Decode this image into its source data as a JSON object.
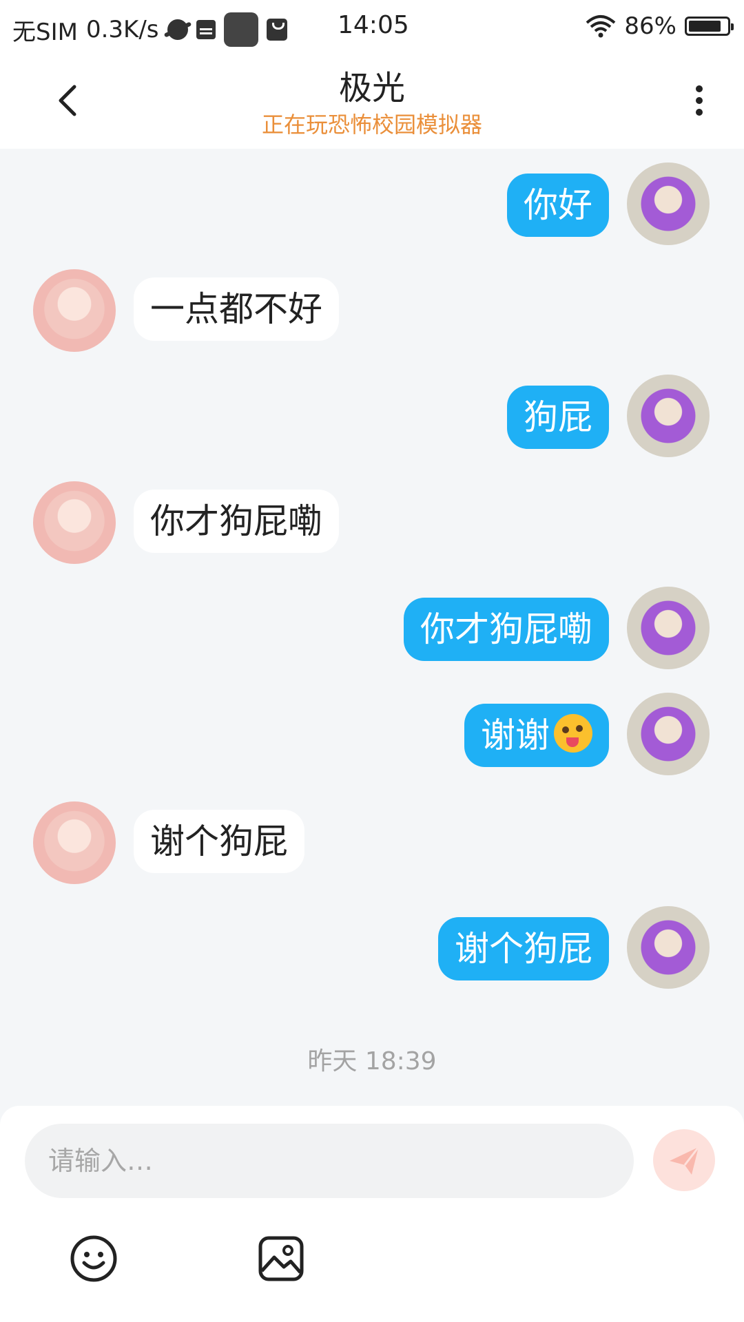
{
  "status_bar": {
    "carrier": "无SIM",
    "speed": "0.3K/s",
    "time": "14:05",
    "battery": "86%",
    "battery_level": 0.86
  },
  "header": {
    "title": "极光",
    "subtitle": "正在玩恐怖校园模拟器"
  },
  "messages": [
    {
      "side": "self",
      "text": "你好"
    },
    {
      "side": "other",
      "text": "一点都不好"
    },
    {
      "side": "self",
      "text": "狗屁"
    },
    {
      "side": "other",
      "text": "你才狗屁嘞"
    },
    {
      "side": "self",
      "text": "你才狗屁嘞"
    },
    {
      "side": "self",
      "text": "谢谢",
      "emoji": "winking-tongue-emoji"
    },
    {
      "side": "other",
      "text": "谢个狗屁"
    },
    {
      "side": "self",
      "text": "谢个狗屁"
    }
  ],
  "timestamp": "昨天 18:39",
  "input": {
    "placeholder": "请输入…",
    "value": ""
  },
  "colors": {
    "self_bubble": "#1fb0f5",
    "subtitle": "#ea8f3a",
    "send_button": "#fde1dc"
  },
  "icons": [
    "back-arrow-icon",
    "more-vertical-icon",
    "send-icon",
    "smiley-icon",
    "image-icon",
    "wifi-icon",
    "battery-icon"
  ]
}
